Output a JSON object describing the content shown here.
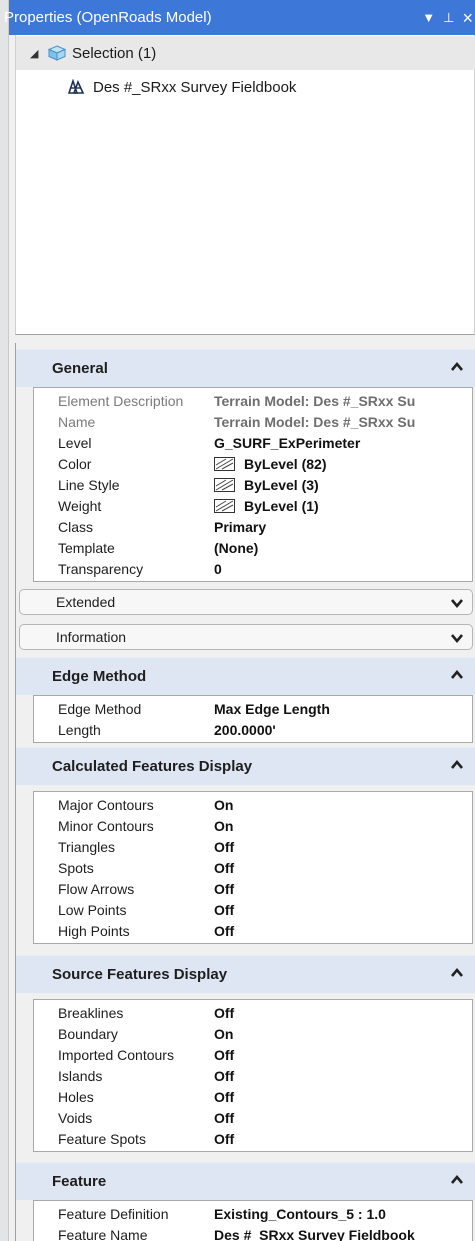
{
  "panel": {
    "title": "Properties (OpenRoads Model)",
    "controls": {
      "menu": "▼",
      "pin": "⊥",
      "close": "×"
    }
  },
  "tree": {
    "root_label": "Selection (1)",
    "child_label": "Des #_SRxx Survey Fieldbook",
    "icons": [
      "collapse-triangle-icon",
      "cube-icon",
      "survey-fieldbook-icon"
    ]
  },
  "sections": {
    "general": {
      "title": "General",
      "rows": [
        {
          "key": "Element Description",
          "value": "Terrain Model: Des #_SRxx Su",
          "readonly": true
        },
        {
          "key": "Name",
          "value": "Terrain Model: Des #_SRxx Su",
          "readonly": true
        },
        {
          "key": "Level",
          "value": "G_SURF_ExPerimeter"
        },
        {
          "key": "Color",
          "value": "ByLevel (82)"
        },
        {
          "key": "Line Style",
          "value": "ByLevel (3)"
        },
        {
          "key": "Weight",
          "value": "ByLevel (1)"
        },
        {
          "key": "Class",
          "value": "Primary"
        },
        {
          "key": "Template",
          "value": "(None)"
        },
        {
          "key": "Transparency",
          "value": "0"
        }
      ]
    },
    "extended": {
      "title": "Extended"
    },
    "information": {
      "title": "Information"
    },
    "edge_method": {
      "title": "Edge Method",
      "rows": [
        {
          "key": "Edge Method",
          "value": "Max Edge Length"
        },
        {
          "key": "Length",
          "value": "200.0000'"
        }
      ]
    },
    "calculated": {
      "title": "Calculated Features Display",
      "rows": [
        {
          "key": "Major Contours",
          "value": "On"
        },
        {
          "key": "Minor Contours",
          "value": "On"
        },
        {
          "key": "Triangles",
          "value": "Off"
        },
        {
          "key": "Spots",
          "value": "Off"
        },
        {
          "key": "Flow Arrows",
          "value": "Off"
        },
        {
          "key": "Low Points",
          "value": "Off"
        },
        {
          "key": "High Points",
          "value": "Off"
        }
      ]
    },
    "source": {
      "title": "Source Features Display",
      "rows": [
        {
          "key": "Breaklines",
          "value": "Off"
        },
        {
          "key": "Boundary",
          "value": "On"
        },
        {
          "key": "Imported Contours",
          "value": "Off"
        },
        {
          "key": "Islands",
          "value": "Off"
        },
        {
          "key": "Holes",
          "value": "Off"
        },
        {
          "key": "Voids",
          "value": "Off"
        },
        {
          "key": "Feature Spots",
          "value": "Off"
        }
      ]
    },
    "feature": {
      "title": "Feature",
      "rows": [
        {
          "key": "Feature Definition",
          "value": "Existing_Contours_5 : 1.0"
        },
        {
          "key": "Feature Name",
          "value": "Des #_SRxx Survey Fieldbook"
        }
      ]
    }
  },
  "colors": {
    "title_bar": "#3d78d8",
    "section_header": "#dfe6f3"
  }
}
